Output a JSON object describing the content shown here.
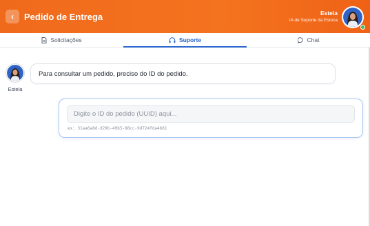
{
  "header": {
    "back_icon": "chevron-left-icon",
    "title": "Pedido de Entrega",
    "user_name": "Estela",
    "user_role": "IA de Suporte da Estoca",
    "status": "online"
  },
  "tabs": [
    {
      "label": "Solicitações",
      "icon": "document-icon",
      "active": false
    },
    {
      "label": "Suporte",
      "icon": "headset-icon",
      "active": true
    },
    {
      "label": "Chat",
      "icon": "chat-bubble-icon",
      "active": false
    }
  ],
  "messages": [
    {
      "author": "Estela",
      "text": "Para consultar um pedido, preciso do ID do pedido."
    }
  ],
  "order_input": {
    "value": "",
    "placeholder": "Digite o ID do pedido (UUID) aqui...",
    "example": "ex: 31aa6a8d-d29b-49b5-88cc-9d724fda4b61"
  },
  "colors": {
    "header_orange": "#f06a1c",
    "accent_blue": "#2563c9",
    "online_green": "#2ec264"
  }
}
